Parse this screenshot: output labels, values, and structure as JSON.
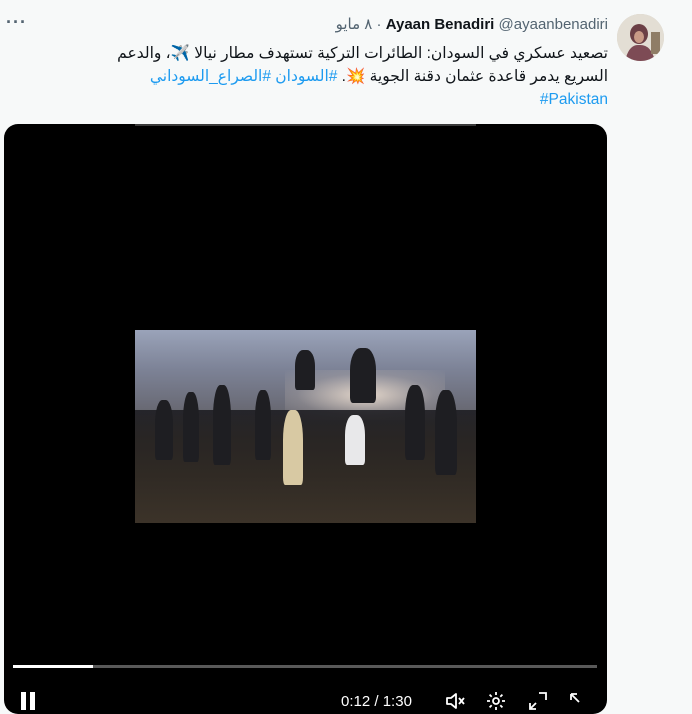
{
  "tweet": {
    "more_label": "···",
    "display_name": "Ayaan Benadiri",
    "handle": "@ayaanbenadiri",
    "dot": "·",
    "date": "٨ مايو",
    "text_line1": "تصعيد عسكري في السودان: الطائرات التركية تستهدف مطار نيالا ✈️، والدعم",
    "text_line2_plain": "السريع يدمر قاعدة عثمان دقنة الجوية 💥. ",
    "hashtags": [
      "#السودان",
      "#الصراع_السوداني",
      "#Pakistan"
    ]
  },
  "video": {
    "current_time": "0:12",
    "separator": "/",
    "duration": "1:30",
    "progress": 0.137,
    "icons": [
      "pause-icon",
      "volume-muted-icon",
      "settings-icon",
      "fullscreen-icon",
      "expand-icon"
    ]
  },
  "colors": {
    "accent": "#1d9bf0",
    "text": "#0f1419",
    "muted": "#536471",
    "background": "#f7f9f9"
  }
}
